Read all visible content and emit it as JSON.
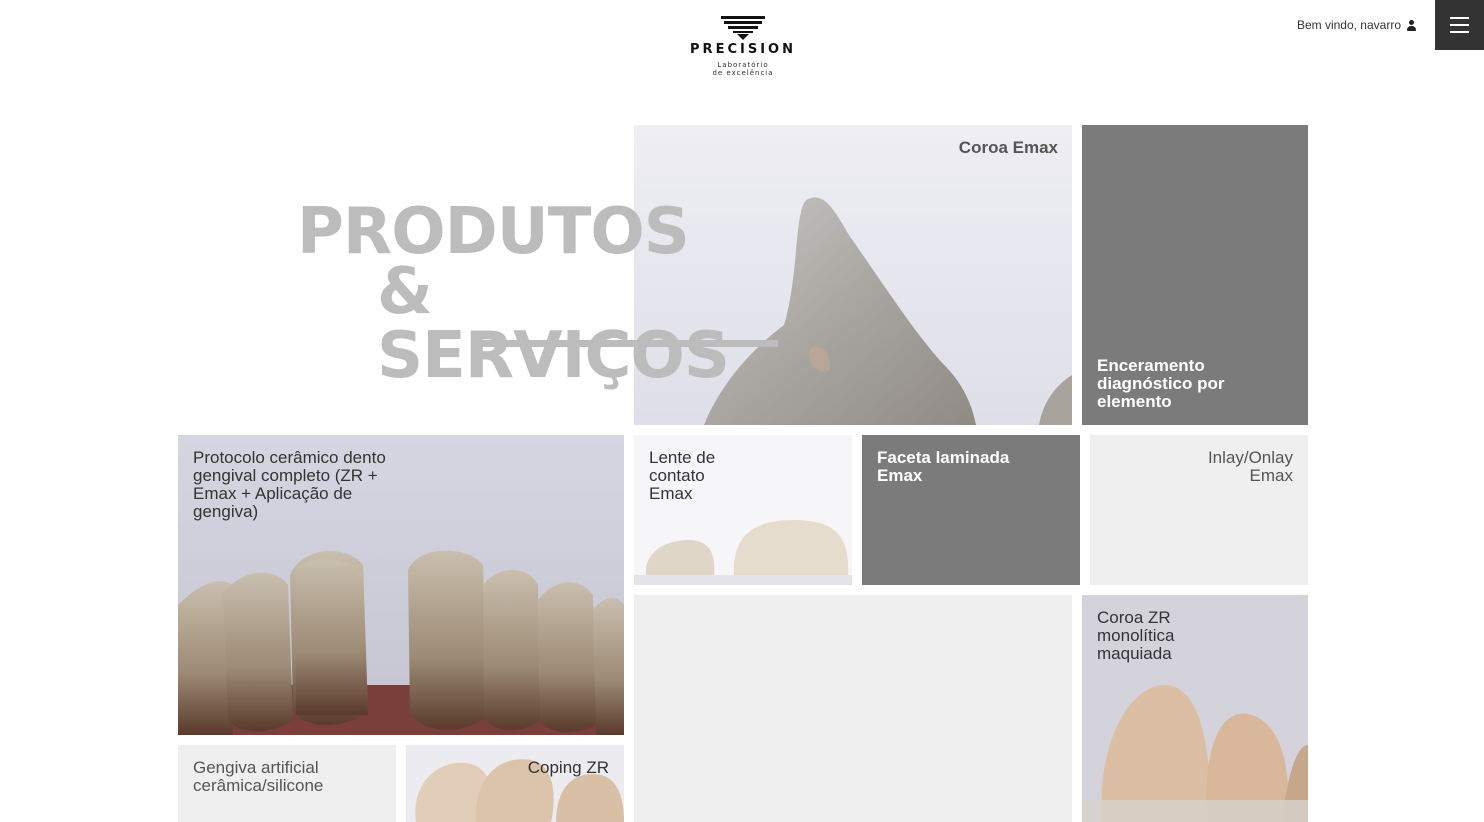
{
  "brand": {
    "name": "PRECISION",
    "tagline_line1": "Laboratório",
    "tagline_line2": "de excelência"
  },
  "header": {
    "welcome_text": "Bem vindo, navarro",
    "user_icon": "user-icon",
    "menu_icon": "hamburger-menu-icon"
  },
  "hero": {
    "line1": "PRODUTOS",
    "line2": "& SERVIÇOS"
  },
  "tiles": [
    {
      "label": "Coroa Emax",
      "style": "photo"
    },
    {
      "label": "Enceramento diagnóstico por elemento",
      "style": "dark"
    },
    {
      "label": "Protocolo cerâmico dento gengival completo (ZR + Emax + Aplicação de gengiva)",
      "style": "photo"
    },
    {
      "label": "Lente de contato Emax",
      "style": "photo"
    },
    {
      "label": "Faceta laminada Emax",
      "style": "dark"
    },
    {
      "label": "Inlay/Onlay Emax",
      "style": "light"
    },
    {
      "label": "",
      "style": "light"
    },
    {
      "label": "Coroa ZR monolítica maquiada",
      "style": "photo"
    },
    {
      "label": "Gengiva artificial cerâmica/silicone",
      "style": "light"
    },
    {
      "label": "Coping ZR",
      "style": "photo"
    }
  ],
  "colors": {
    "dark_tile": "#7b7b7b",
    "light_tile": "#efefef",
    "hero_text": "#bcbcbc",
    "menu_button": "#333333"
  }
}
